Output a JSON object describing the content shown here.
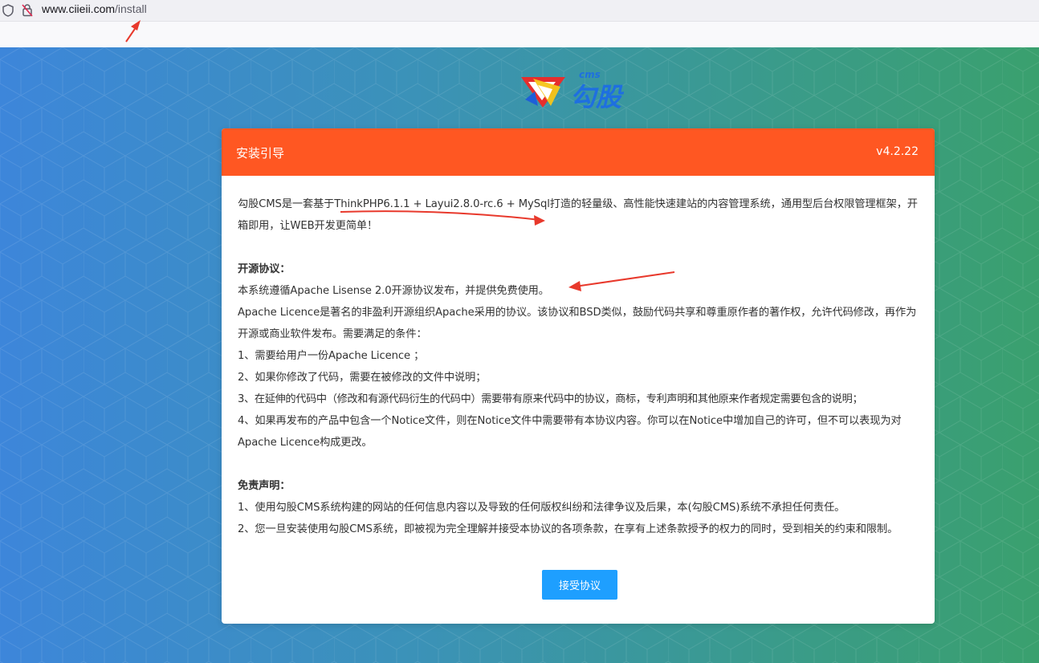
{
  "browser": {
    "url_host": "www.ciieii.com",
    "url_path": "/install"
  },
  "logo": {
    "brand_text": "勾股",
    "cms_text": "cms"
  },
  "card": {
    "title": "安装引导",
    "version": "v4.2.22",
    "intro": "勾股CMS是一套基于ThinkPHP6.1.1 + Layui2.8.0-rc.6 + MySql打造的轻量级、高性能快速建站的内容管理系统，通用型后台权限管理框架，开箱即用，让WEB开发更简单！",
    "license_heading": "开源协议：",
    "license_lines": [
      "本系统遵循Apache Lisense 2.0开源协议发布，并提供免费使用。",
      "Apache Licence是著名的非盈利开源组织Apache采用的协议。该协议和BSD类似，鼓励代码共享和尊重原作者的著作权，允许代码修改，再作为开源或商业软件发布。需要满足的条件：",
      "1、需要给用户一份Apache Licence ；",
      "2、如果你修改了代码，需要在被修改的文件中说明；",
      "3、在延伸的代码中（修改和有源代码衍生的代码中）需要带有原来代码中的协议，商标，专利声明和其他原来作者规定需要包含的说明；",
      "4、如果再发布的产品中包含一个Notice文件，则在Notice文件中需要带有本协议内容。你可以在Notice中增加自己的许可，但不可以表现为对Apache Licence构成更改。"
    ],
    "disclaimer_heading": "免责声明：",
    "disclaimer_lines": [
      "1、使用勾股CMS系统构建的网站的任何信息内容以及导致的任何版权纠纷和法律争议及后果，本(勾股CMS)系统不承担任何责任。",
      "2、您一旦安装使用勾股CMS系统，即被视为完全理解并接受本协议的各项条款，在享有上述条款授予的权力的同时，受到相关的约束和限制。"
    ],
    "accept_label": "接受协议"
  },
  "colors": {
    "header": "#ff5722",
    "button": "#1e9fff",
    "annotation": "#e8392c"
  }
}
